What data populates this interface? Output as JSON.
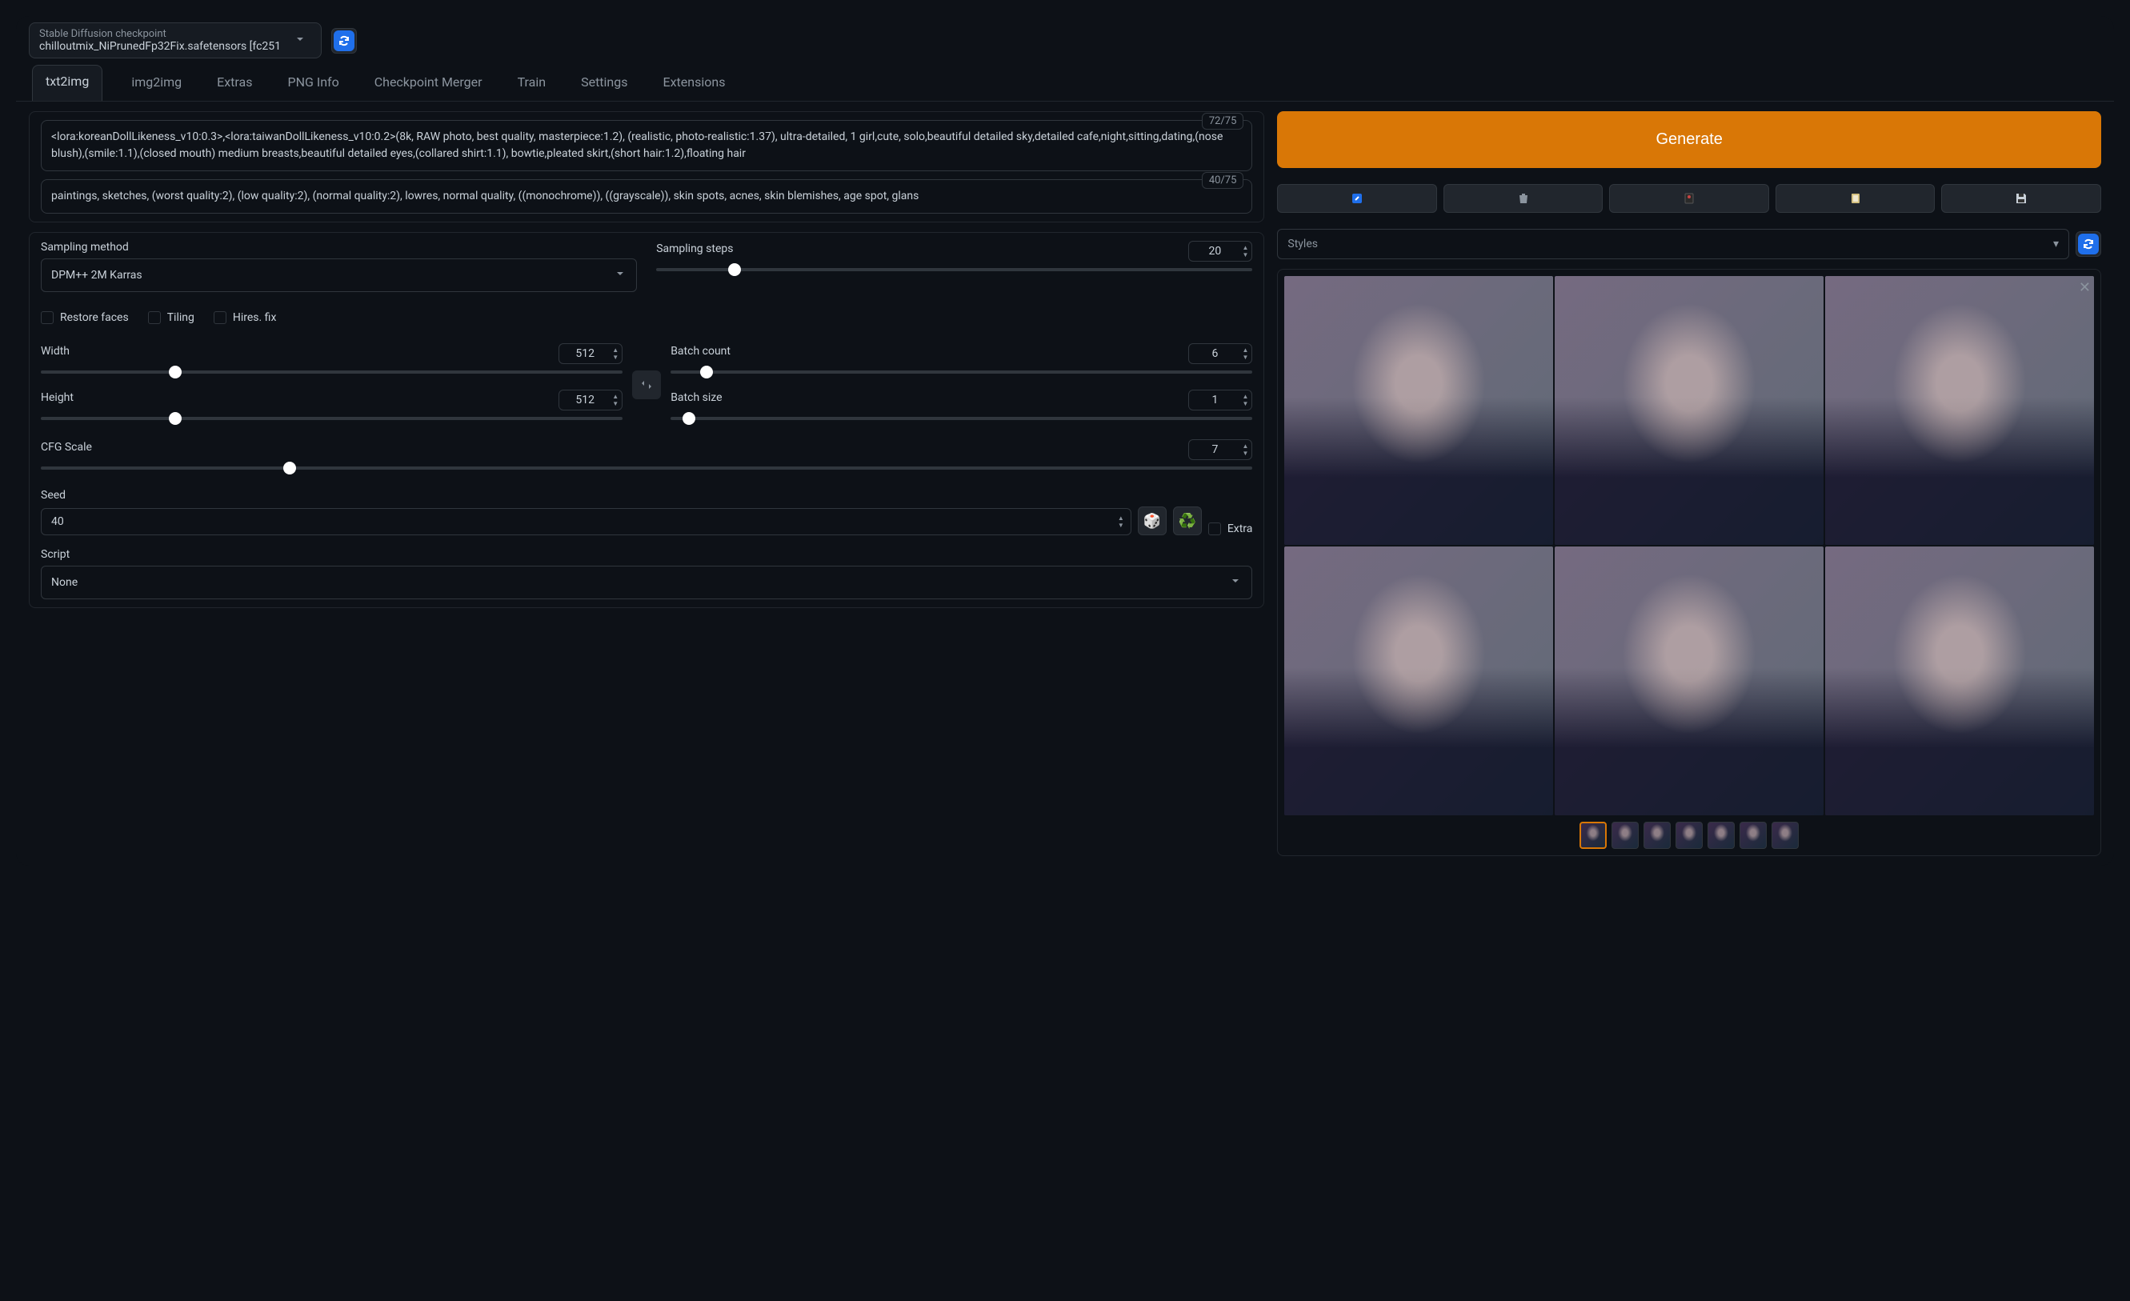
{
  "checkpoint": {
    "label": "Stable Diffusion checkpoint",
    "value": "chilloutmix_NiPrunedFp32Fix.safetensors [fc251"
  },
  "tabs": [
    "txt2img",
    "img2img",
    "Extras",
    "PNG Info",
    "Checkpoint Merger",
    "Train",
    "Settings",
    "Extensions"
  ],
  "active_tab": "txt2img",
  "prompt": {
    "positive": "<lora:koreanDollLikeness_v10:0.3>,<lora:taiwanDollLikeness_v10:0.2>(8k, RAW photo, best quality, masterpiece:1.2), (realistic, photo-realistic:1.37), ultra-detailed, 1 girl,cute, solo,beautiful detailed sky,detailed cafe,night,sitting,dating,(nose blush),(smile:1.1),(closed mouth) medium breasts,beautiful detailed eyes,(collared shirt:1.1), bowtie,pleated skirt,(short hair:1.2),floating hair",
    "positive_tokens": "72/75",
    "negative": "paintings, sketches, (worst quality:2), (low quality:2), (normal quality:2), lowres, normal quality, ((monochrome)), ((grayscale)), skin spots, acnes, skin blemishes, age spot, glans",
    "negative_tokens": "40/75"
  },
  "generate_label": "Generate",
  "styles_label": "Styles",
  "sampling": {
    "method_label": "Sampling method",
    "method_value": "DPM++ 2M Karras",
    "steps_label": "Sampling steps",
    "steps_value": "20"
  },
  "checkboxes": {
    "restore_faces": "Restore faces",
    "tiling": "Tiling",
    "hires_fix": "Hires. fix"
  },
  "dimensions": {
    "width_label": "Width",
    "width_value": "512",
    "height_label": "Height",
    "height_value": "512"
  },
  "batch": {
    "count_label": "Batch count",
    "count_value": "6",
    "size_label": "Batch size",
    "size_value": "1"
  },
  "cfg": {
    "label": "CFG Scale",
    "value": "7"
  },
  "seed": {
    "label": "Seed",
    "value": "40",
    "extra_label": "Extra"
  },
  "script": {
    "label": "Script",
    "value": "None"
  },
  "gallery": {
    "image_count": 6,
    "thumb_count": 7,
    "active_thumb": 0
  }
}
